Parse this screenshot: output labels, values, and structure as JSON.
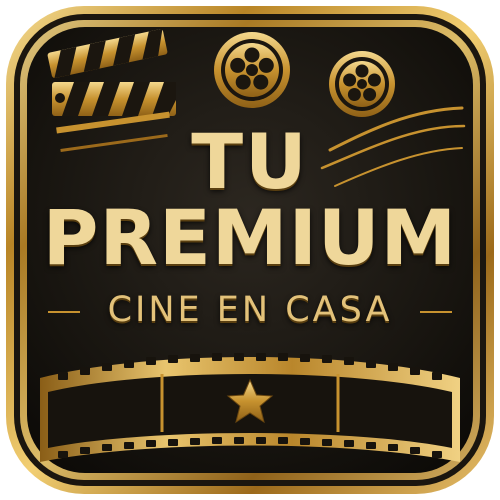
{
  "logo": {
    "title_line_1": "TU",
    "title_line_2": "PREMIUM",
    "subtitle": "CINE EN CASA",
    "icons": [
      "clapperboard-icon",
      "film-reel-icon",
      "film-reel-icon",
      "film-strip-icon",
      "star-icon"
    ],
    "colors": {
      "frame_gold": "#c99a3a",
      "background": "#1a1713",
      "text_gold": "#efd79a"
    }
  }
}
